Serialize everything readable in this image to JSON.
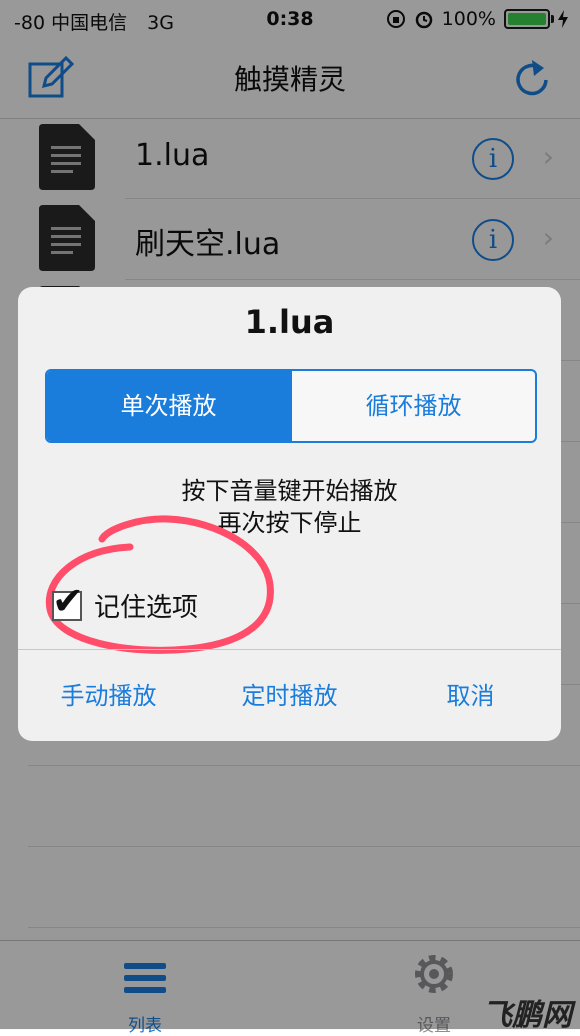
{
  "status": {
    "carrier": "-80 中国电信",
    "network": "3G",
    "time": "0:38",
    "battery": "100%"
  },
  "nav": {
    "title": "触摸精灵"
  },
  "files": [
    {
      "name": "1.lua"
    },
    {
      "name": "刷天空.lua"
    }
  ],
  "alert": {
    "title": "1.lua",
    "segments": {
      "single": "单次播放",
      "loop": "循环播放"
    },
    "message_line1": "按下音量键开始播放",
    "message_line2": "再次按下停止",
    "remember_label": "记住选项",
    "remember_checked": true,
    "buttons": {
      "manual": "手动播放",
      "timed": "定时播放",
      "cancel": "取消"
    }
  },
  "tabs": {
    "list": "列表",
    "settings": "设置"
  },
  "watermark": "飞鹏网",
  "colors": {
    "accent": "#1a7ddc",
    "highlight": "#ff4d6a"
  }
}
